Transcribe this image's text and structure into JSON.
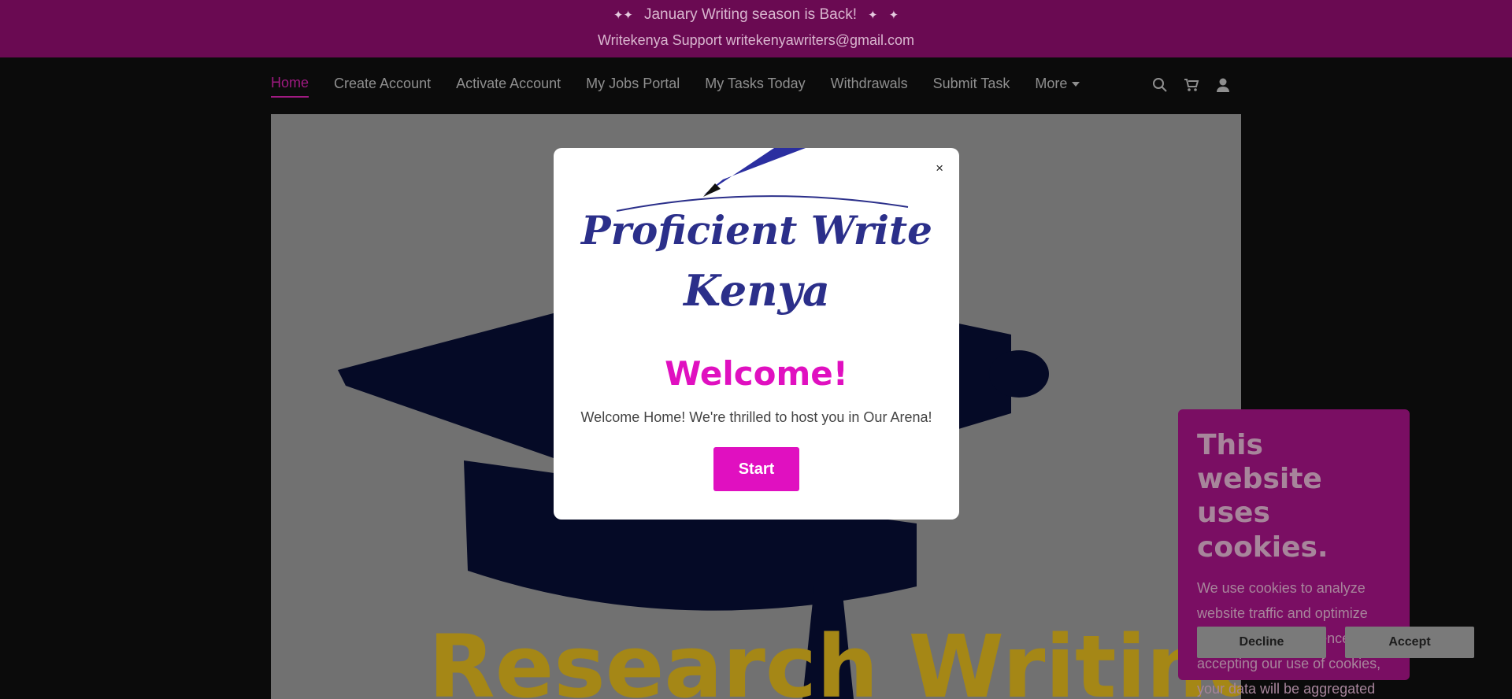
{
  "announcement": {
    "line1": "January Writing season is Back!",
    "line2": "Writekenya Support writekenyawriters@gmail.com"
  },
  "nav": {
    "items": [
      {
        "label": "Home"
      },
      {
        "label": "Create Account"
      },
      {
        "label": "Activate Account"
      },
      {
        "label": "My Jobs Portal"
      },
      {
        "label": "My Tasks Today"
      },
      {
        "label": "Withdrawals"
      },
      {
        "label": "Submit Task"
      },
      {
        "label": "More"
      }
    ],
    "icons": [
      "search-icon",
      "cart-icon",
      "user-icon"
    ]
  },
  "hero": {
    "logo_text": "Research Writing"
  },
  "modal": {
    "logo_line1": "Proficient Write",
    "logo_line2": "Kenya",
    "title": "Welcome!",
    "message": "Welcome Home! We're thrilled to host you in Our Arena!",
    "start_label": "Start",
    "close_label": "×"
  },
  "cookie": {
    "title": "This website uses cookies.",
    "body": "We use cookies to analyze website traffic and optimize your website experience. By accepting our use of cookies, your data will be aggregated with all other user data.",
    "decline_label": "Decline",
    "accept_label": "Accept"
  },
  "colors": {
    "accent": "#e010c0",
    "banner": "#6a0a52",
    "cookie_bg": "#7a0e63"
  }
}
